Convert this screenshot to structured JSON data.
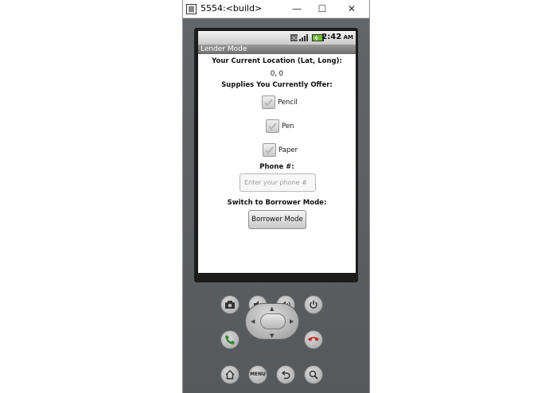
{
  "window": {
    "title": "5554:<build>",
    "minimize": "—",
    "maximize": "☐",
    "close": "✕"
  },
  "statusbar": {
    "time": "2:42",
    "ampm": "AM"
  },
  "app": {
    "title": "Lender Mode",
    "location_label": "Your Current Location (Lat, Long):",
    "location_value": "0, 0",
    "supplies_label": "Supplies You Currently Offer:",
    "supplies": [
      {
        "label": "Pencil",
        "checked": true
      },
      {
        "label": "Pen",
        "checked": true
      },
      {
        "label": "Paper",
        "checked": true
      }
    ],
    "phone_label": "Phone #:",
    "phone_placeholder": "Enter your phone #",
    "switch_label": "Switch to Borrower Mode:",
    "switch_button": "Borrower Mode"
  },
  "keypad": {
    "menu_label": "MENU"
  }
}
